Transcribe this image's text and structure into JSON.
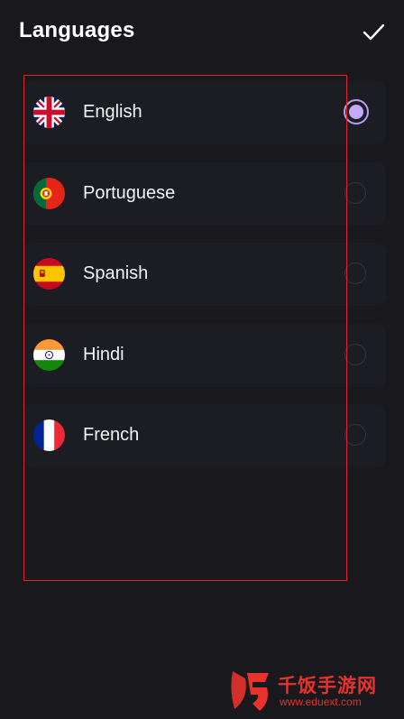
{
  "header": {
    "title": "Languages",
    "done_icon": "checkmark-icon"
  },
  "languages": [
    {
      "label": "English",
      "flag": "uk-flag-icon",
      "selected": true
    },
    {
      "label": "Portuguese",
      "flag": "portugal-flag-icon",
      "selected": false
    },
    {
      "label": "Spanish",
      "flag": "spain-flag-icon",
      "selected": false
    },
    {
      "label": "Hindi",
      "flag": "india-flag-icon",
      "selected": false
    },
    {
      "label": "French",
      "flag": "france-flag-icon",
      "selected": false
    }
  ],
  "colors": {
    "background": "#18181d",
    "row": "#1c1d23",
    "accent": "#c4a9f7",
    "highlight": "#e0242f"
  },
  "watermark": {
    "name": "千饭手游网",
    "url": "www.eduext.com"
  }
}
